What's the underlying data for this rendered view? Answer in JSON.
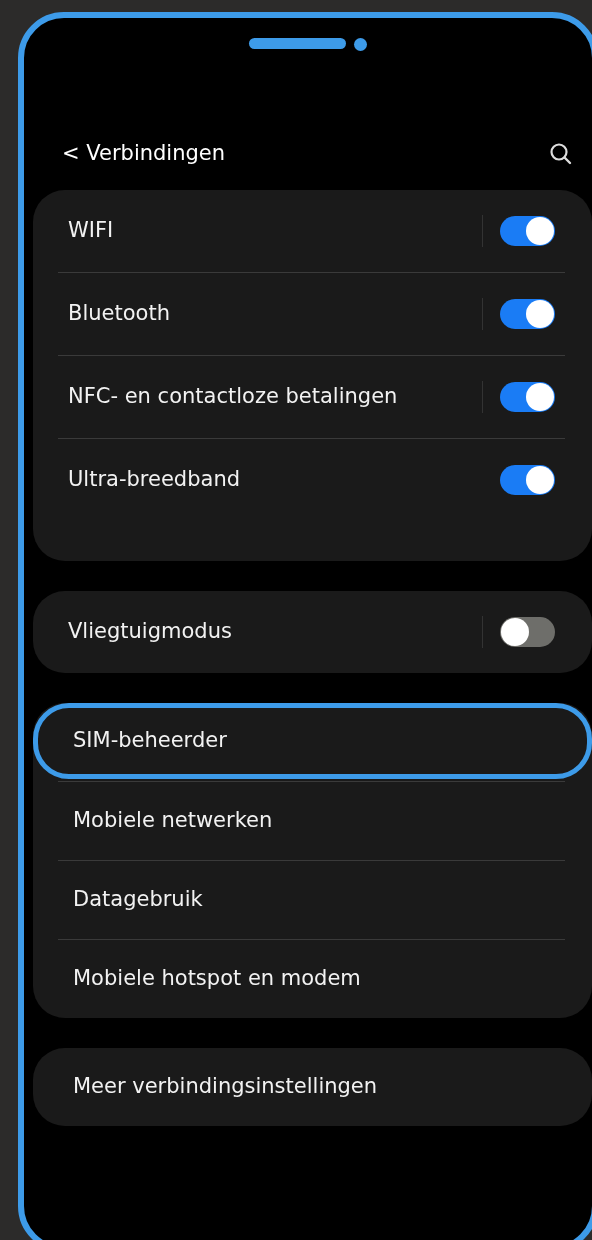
{
  "header": {
    "title": "< Verbindingen"
  },
  "groups": [
    {
      "items": [
        {
          "kind": "toggle",
          "label": "WIFI",
          "on": true,
          "separator": true
        },
        {
          "kind": "toggle",
          "label": "Bluetooth",
          "on": true,
          "separator": true
        },
        {
          "kind": "toggle",
          "label": "NFC- en contactloze betalingen",
          "on": true,
          "separator": true
        },
        {
          "kind": "toggle",
          "label": "Ultra-breedband",
          "on": true,
          "separator": false
        }
      ]
    },
    {
      "items": [
        {
          "kind": "toggle",
          "label": "Vliegtuigmodus",
          "on": false,
          "separator": true
        }
      ]
    },
    {
      "items": [
        {
          "kind": "link",
          "label": "SIM-beheerder",
          "selected": true
        },
        {
          "kind": "link",
          "label": "Mobiele netwerken",
          "selected": false
        },
        {
          "kind": "link",
          "label": "Datagebruik",
          "selected": false
        },
        {
          "kind": "link",
          "label": "Mobiele hotspot en modem",
          "selected": false
        }
      ]
    },
    {
      "items": [
        {
          "kind": "link",
          "label": "Meer verbindingsinstellingen",
          "selected": false
        }
      ]
    }
  ]
}
